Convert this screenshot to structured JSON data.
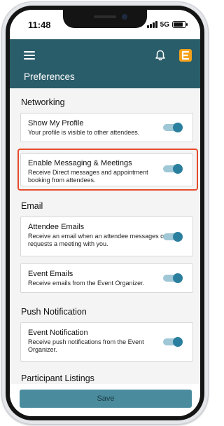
{
  "status_bar": {
    "time": "11:48",
    "network": "5G",
    "battery_level": 0.8
  },
  "header": {
    "title": "Preferences",
    "logo_letter": "E",
    "bar_color": "#2a5d6a",
    "logo_color": "#f4a11b"
  },
  "sections": {
    "networking": {
      "title": "Networking",
      "show_profile": {
        "title": "Show My Profile",
        "desc": "Your profile is visible to other attendees.",
        "enabled": true
      },
      "messaging": {
        "title": "Enable Messaging & Meetings",
        "desc": "Receive Direct messages and appointment booking from attendees.",
        "enabled": true
      }
    },
    "email": {
      "title": "Email",
      "attendee_emails": {
        "title": "Attendee Emails",
        "desc": "Receive an email when an attendee messages or requests a meeting with you.",
        "enabled": true
      },
      "event_emails": {
        "title": "Event Emails",
        "desc": "Receive emails from the Event Organizer.",
        "enabled": true
      }
    },
    "push": {
      "title": "Push Notification",
      "event_notification": {
        "title": "Event Notification",
        "desc": "Receive push notifications from the Event Organizer.",
        "enabled": true
      }
    },
    "participant_listings": {
      "title": "Participant Listings"
    }
  },
  "footer": {
    "save_label": "Save"
  },
  "colors": {
    "toggle_track": "#9fc7d6",
    "toggle_knob": "#2b7f9e",
    "highlight": "#e64b2c",
    "save_button": "#4a8c9e"
  },
  "icons": {
    "menu": "hamburger-menu-icon",
    "notifications": "bell-icon",
    "logo": "event-logo-icon"
  }
}
